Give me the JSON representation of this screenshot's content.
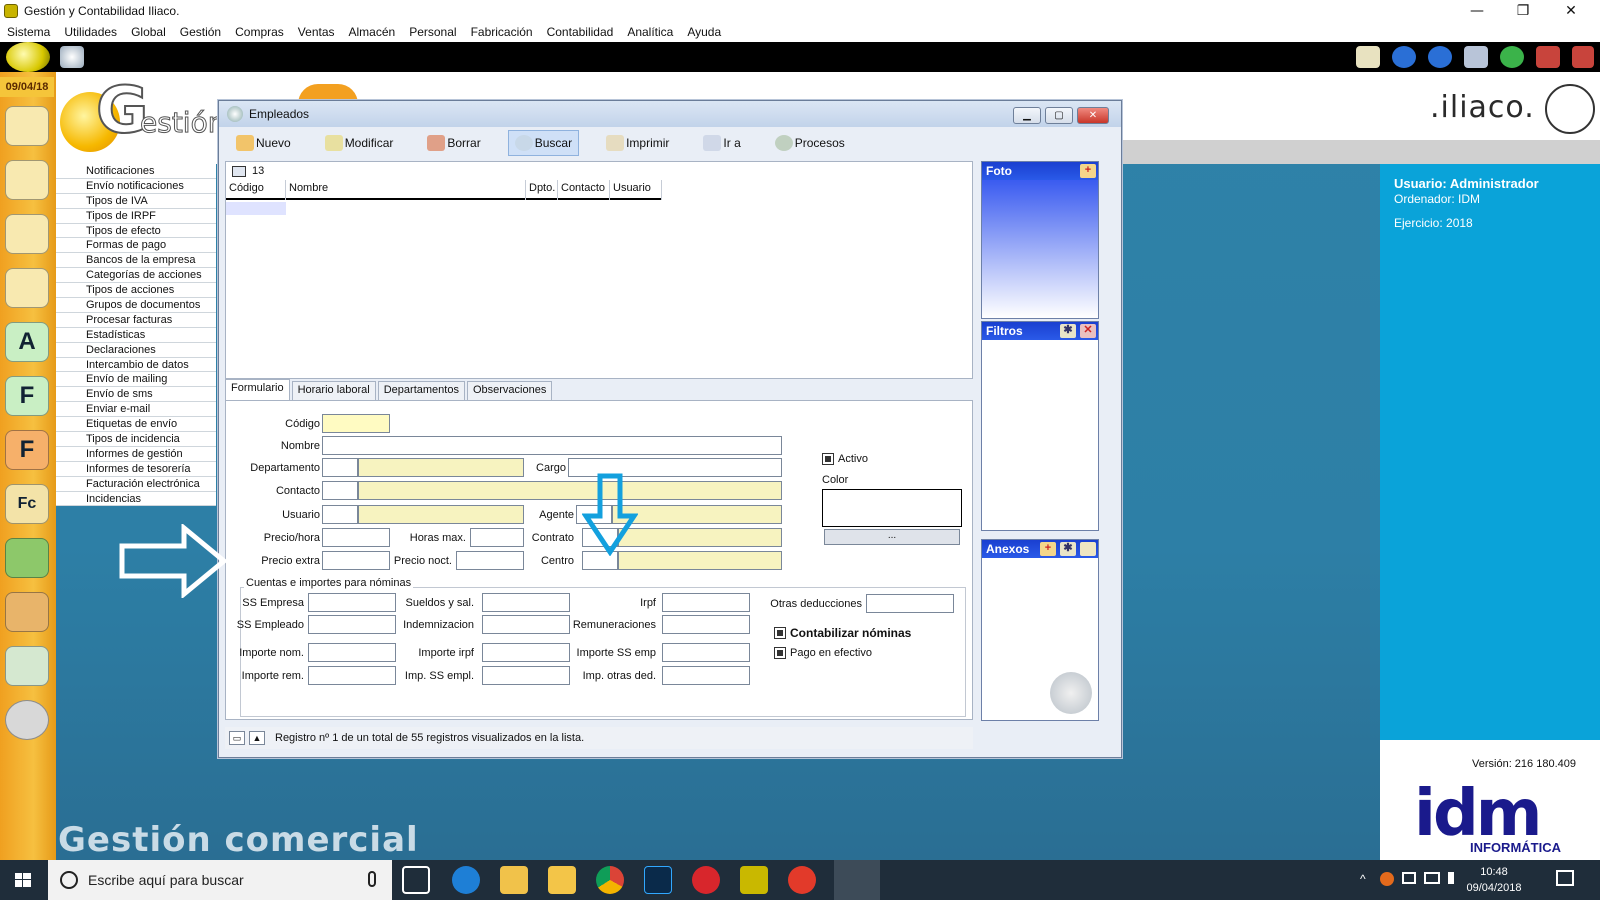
{
  "window": {
    "title": "Gestión y Contabilidad Iliaco.",
    "minimize": "—",
    "maximize": "❐",
    "close": "✕"
  },
  "menu": [
    "Sistema",
    "Utilidades",
    "Global",
    "Gestión",
    "Compras",
    "Ventas",
    "Almacén",
    "Personal",
    "Fabricación",
    "Contabilidad",
    "Analítica",
    "Ayuda"
  ],
  "sidebar": {
    "date": "09/04/18",
    "items": [
      "Notificaciones",
      "Envío notificaciones",
      "Tipos de IVA",
      "Tipos de IRPF",
      "Tipos de efecto",
      "Formas de pago",
      "Bancos de la empresa",
      "Categorías de acciones",
      "Tipos de acciones",
      "Grupos de documentos",
      "Procesar facturas",
      "Estadísticas",
      "Declaraciones",
      "Intercambio de datos",
      "Envío de mailing",
      "Envío de sms",
      "Enviar e-mail",
      "Etiquetas de envío",
      "Tipos de incidencia",
      "Informes de gestión",
      "Informes de tesorería",
      "Facturación electrónica",
      "Incidencias"
    ]
  },
  "background": {
    "logo_text": "G",
    "logo_text2": "estión",
    "brand": ".iliaco.",
    "caption": "Gestión comercial"
  },
  "right_panel": {
    "user": "Usuario: Administrador",
    "computer": "Ordenador: IDM",
    "year": "Ejercicio: 2018",
    "version": "Versión: 216 180.409",
    "idm": "idm",
    "idm_sub": "INFORMÁTICA"
  },
  "dialog": {
    "title": "Empleados",
    "toolbar": [
      "Nuevo",
      "Modificar",
      "Borrar",
      "Buscar",
      "Imprimir",
      "Ir a",
      "Procesos"
    ],
    "active_tool": "Buscar",
    "grid": {
      "count": "13",
      "columns": [
        "Código",
        "Nombre",
        "Dpto.",
        "Contacto",
        "Usuario"
      ]
    },
    "panes": {
      "foto": "Foto",
      "filtros": "Filtros",
      "anexos": "Anexos"
    },
    "tabs": [
      "Formulario",
      "Horario laboral",
      "Departamentos",
      "Observaciones"
    ],
    "form": {
      "codigo": "Código",
      "nombre": "Nombre",
      "departamento": "Departamento",
      "cargo": "Cargo",
      "contacto": "Contacto",
      "usuario": "Usuario",
      "agente": "Agente",
      "precio_hora": "Precio/hora",
      "horas_max": "Horas max.",
      "contrato": "Contrato",
      "precio_extra": "Precio extra",
      "precio_noct": "Precio noct.",
      "centro": "Centro",
      "activo": "Activo",
      "color": "Color",
      "color_btn": "...",
      "group_title": "Cuentas e importes para nóminas",
      "ss_empresa": "SS Empresa",
      "sueldos": "Sueldos y sal.",
      "irpf": "Irpf",
      "otras_ded": "Otras deducciones",
      "ss_empleado": "SS Empleado",
      "indemnizacion": "Indemnizacion",
      "remuneraciones": "Remuneraciones",
      "contabilizar": "Contabilizar nóminas",
      "importe_nom": "Importe nom.",
      "importe_irpf": "Importe irpf",
      "importe_ss_emp": "Importe SS emp",
      "pago_efectivo": "Pago en efectivo",
      "importe_rem": "Importe rem.",
      "imp_ss_empl": "Imp. SS empl.",
      "imp_otras_ded": "Imp. otras ded."
    },
    "status": "Registro nº 1 de un total de 55 registros visualizados en la lista."
  },
  "taskbar": {
    "search_placeholder": "Escribe aquí para buscar",
    "time": "10:48",
    "date": "09/04/2018"
  },
  "colors": {
    "accent_blue": "#0aa3d9",
    "pane_head": "#1a3fd0",
    "required_field": "#fffbc2"
  }
}
